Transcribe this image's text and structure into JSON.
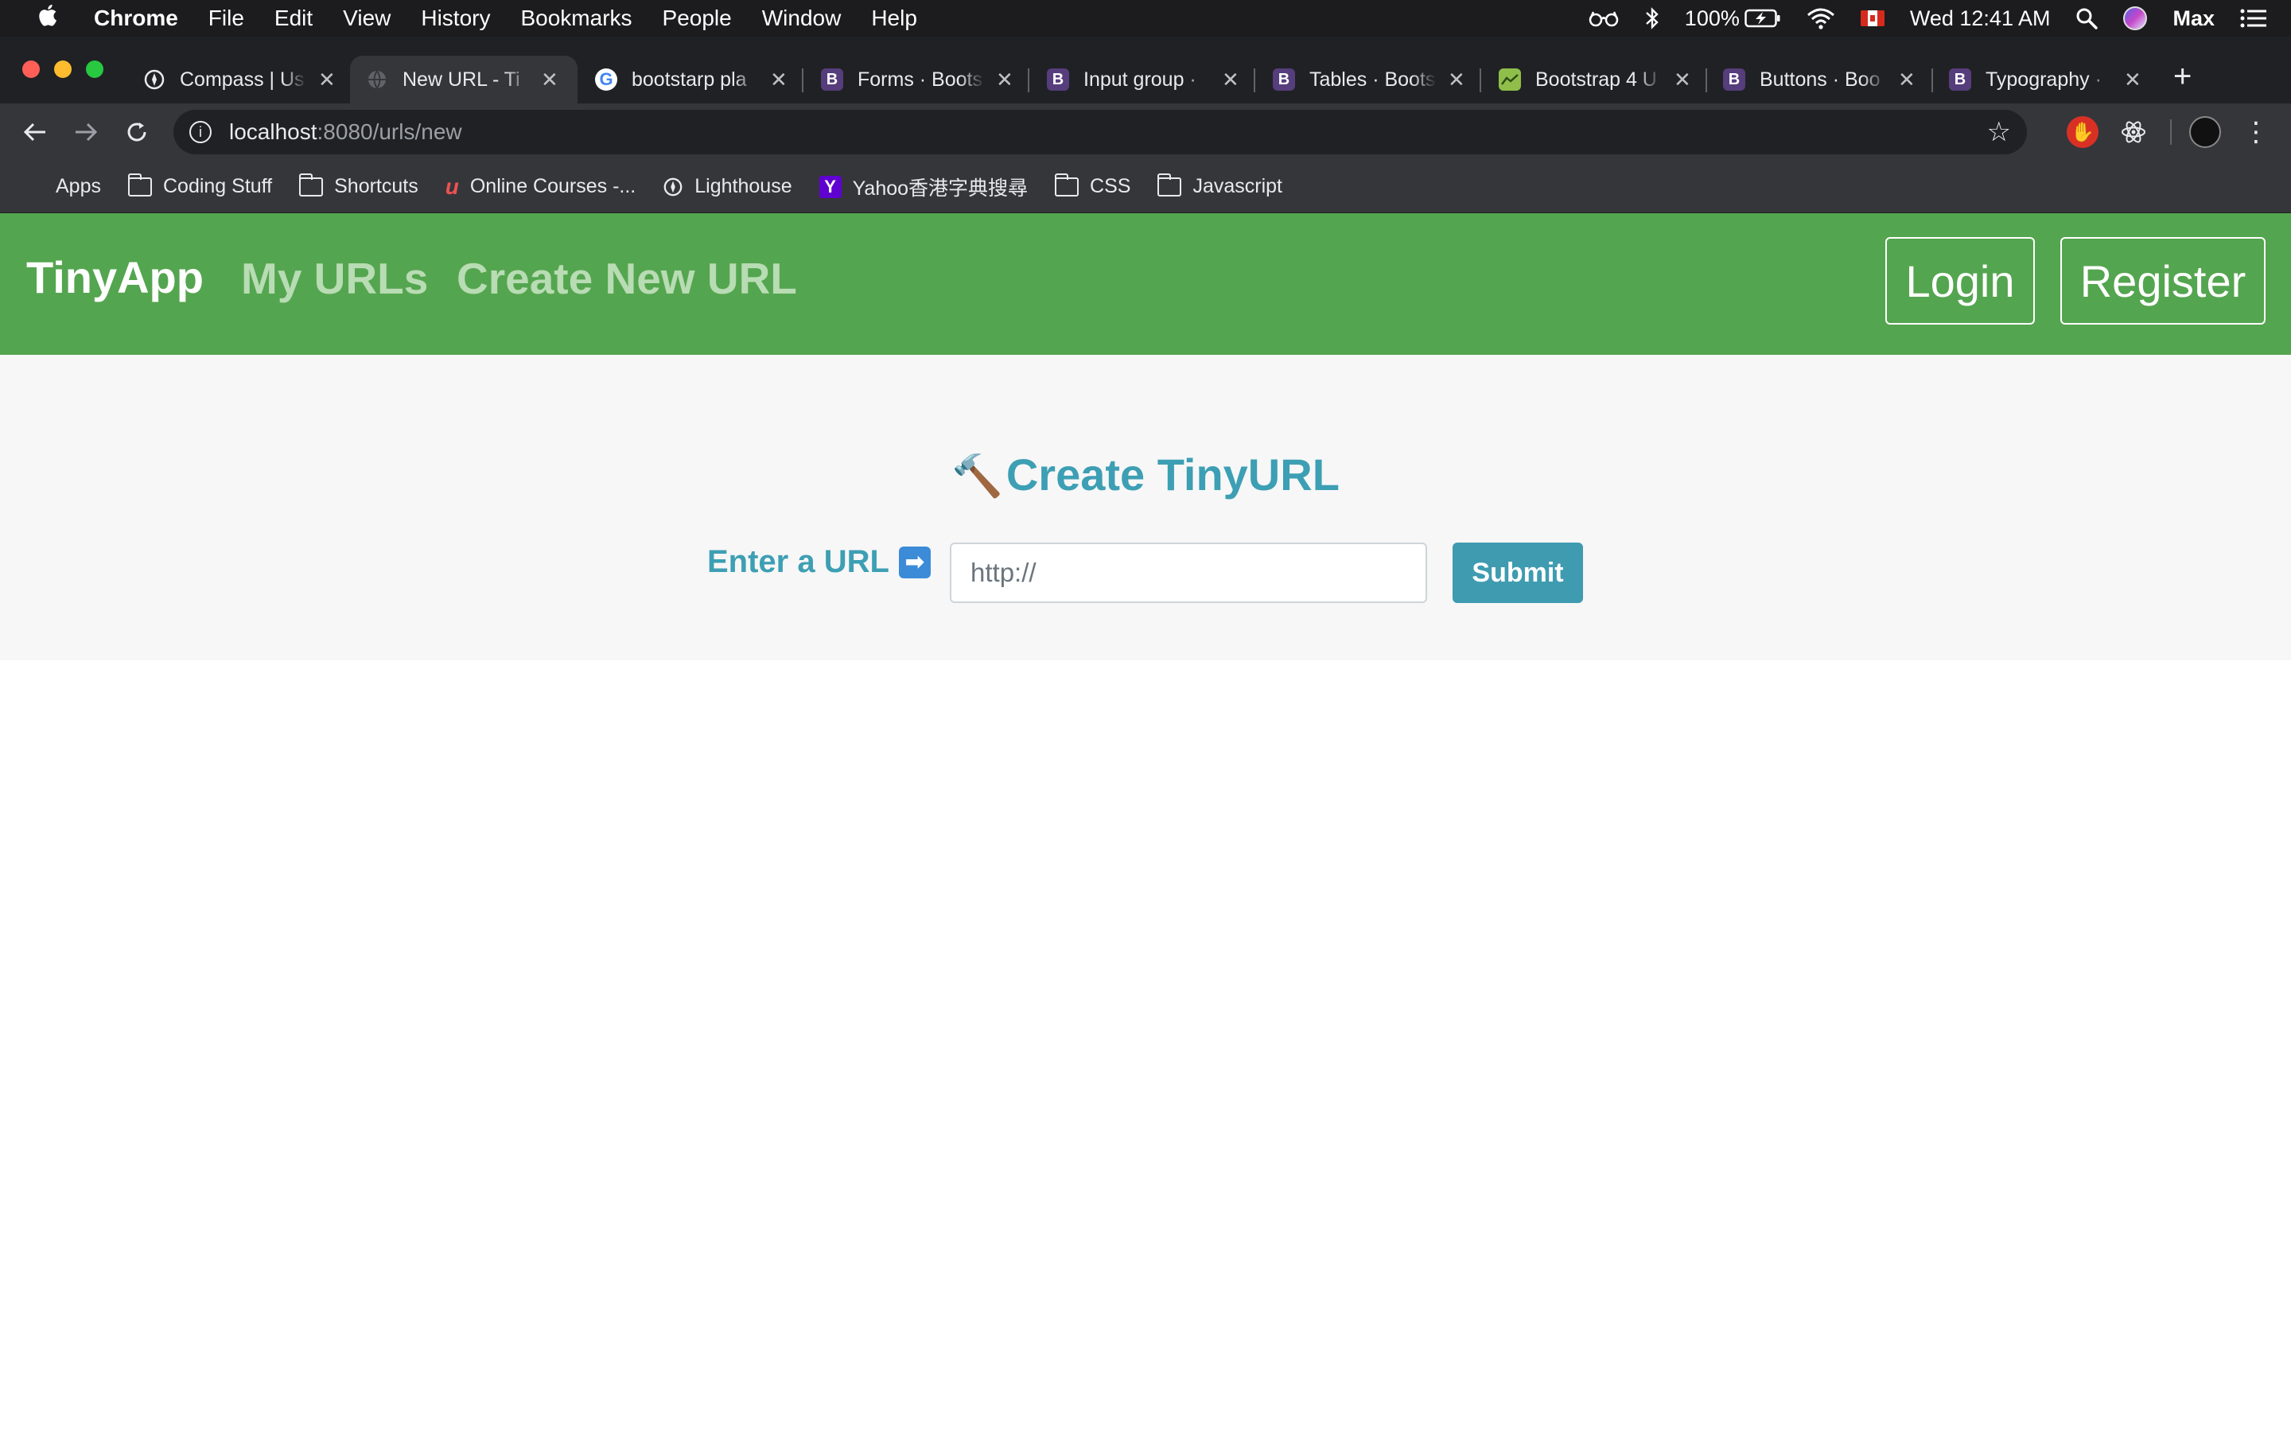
{
  "menubar": {
    "app_name": "Chrome",
    "items": [
      "File",
      "Edit",
      "View",
      "History",
      "Bookmarks",
      "People",
      "Window",
      "Help"
    ],
    "battery": "100%",
    "clock": "Wed 12:41 AM",
    "user": "Max"
  },
  "tabs": [
    {
      "title": "Compass | Us",
      "favicon": "compass-icon",
      "active": false
    },
    {
      "title": "New URL - Ti",
      "favicon": "globe-icon",
      "active": true
    },
    {
      "title": "bootstarp pla",
      "favicon": "google-icon",
      "active": false
    },
    {
      "title": "Forms · Boots",
      "favicon": "bootstrap-icon",
      "active": false
    },
    {
      "title": "Input group · ",
      "favicon": "bootstrap-icon",
      "active": false
    },
    {
      "title": "Tables · Boots",
      "favicon": "bootstrap-icon",
      "active": false
    },
    {
      "title": "Bootstrap 4 U",
      "favicon": "chart-icon",
      "active": false
    },
    {
      "title": "Buttons · Boo",
      "favicon": "bootstrap-icon",
      "active": false
    },
    {
      "title": "Typography · ",
      "favicon": "bootstrap-icon",
      "active": false
    }
  ],
  "address_bar": {
    "host": "localhost",
    "path": ":8080/urls/new"
  },
  "bookmarks": [
    {
      "label": "Apps",
      "icon": "apps-grid-icon"
    },
    {
      "label": "Coding Stuff",
      "icon": "folder-icon"
    },
    {
      "label": "Shortcuts",
      "icon": "folder-icon"
    },
    {
      "label": "Online Courses -...",
      "icon": "udemy-icon"
    },
    {
      "label": "Lighthouse",
      "icon": "compass-icon"
    },
    {
      "label": "Yahoo香港字典搜尋",
      "icon": "yahoo-icon"
    },
    {
      "label": "CSS",
      "icon": "folder-icon"
    },
    {
      "label": "Javascript",
      "icon": "folder-icon"
    }
  ],
  "page": {
    "brand": "TinyApp",
    "nav_links": [
      "My URLs",
      "Create New URL"
    ],
    "login_label": "Login",
    "register_label": "Register",
    "title": "Create TinyURL",
    "url_label": "Enter a URL",
    "url_placeholder": "http://",
    "submit_label": "Submit"
  },
  "colors": {
    "navbar": "#54a54f",
    "accent": "#3f9bb0"
  }
}
